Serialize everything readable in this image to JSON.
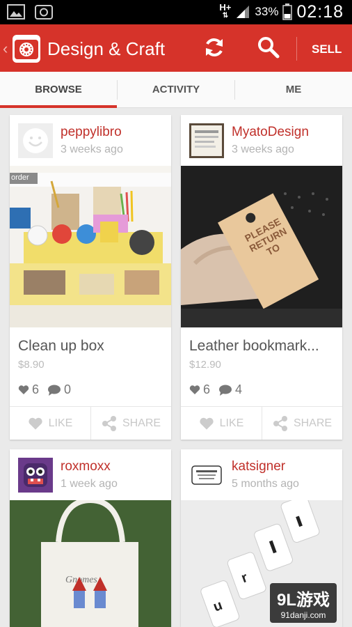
{
  "status_bar": {
    "network": "H+",
    "battery": "33%",
    "time": "02:18"
  },
  "action_bar": {
    "title": "Design & Craft",
    "sell_label": "SELL"
  },
  "tabs": [
    {
      "label": "BROWSE",
      "active": true
    },
    {
      "label": "ACTIVITY",
      "active": false
    },
    {
      "label": "ME",
      "active": false
    }
  ],
  "cards": [
    {
      "username": "peppylibro",
      "time": "3 weeks ago",
      "image_caption": "order",
      "title": "Clean up box",
      "price": "$8.90",
      "likes": "6",
      "comments": "0",
      "like_label": "LIKE",
      "share_label": "SHARE"
    },
    {
      "username": "MyatoDesign",
      "time": "3 weeks ago",
      "image_text": [
        "PLEASE",
        "RETURN",
        "TO"
      ],
      "title": "Leather bookmark...",
      "price": "$12.90",
      "likes": "6",
      "comments": "4",
      "like_label": "LIKE",
      "share_label": "SHARE"
    },
    {
      "username": "roxmoxx",
      "time": "1 week ago"
    },
    {
      "username": "katsigner",
      "time": "5 months ago"
    }
  ],
  "watermark": {
    "main": "9L游戏",
    "sub": "91danji.com"
  },
  "colors": {
    "brand_red": "#d6332a",
    "username_red": "#c0302a"
  }
}
